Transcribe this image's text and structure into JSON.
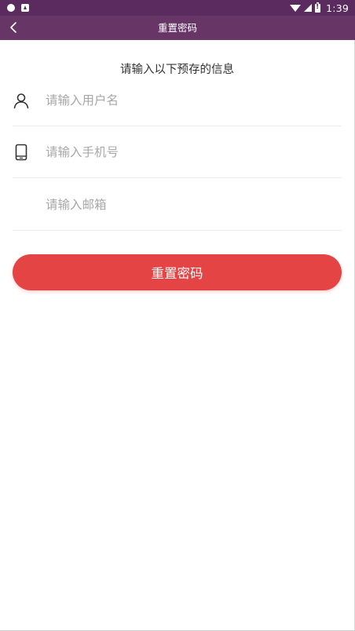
{
  "status_bar": {
    "time": "1:39",
    "icons": [
      "notification-dot-icon",
      "app-a-icon",
      "wifi-icon",
      "signal-icon",
      "battery-alert-icon"
    ]
  },
  "app_bar": {
    "title": "重置密码",
    "back_icon": "chevron-left-icon",
    "background": "#673667"
  },
  "form": {
    "instruction": "请输入以下预存的信息",
    "username": {
      "placeholder": "请输入用户名",
      "value": "",
      "icon": "user-icon"
    },
    "phone": {
      "placeholder": "请输入手机号",
      "value": "",
      "icon": "phone-icon"
    },
    "email": {
      "placeholder": "请输入邮箱",
      "value": ""
    },
    "submit_label": "重置密码",
    "accent_color": "#e44444"
  }
}
